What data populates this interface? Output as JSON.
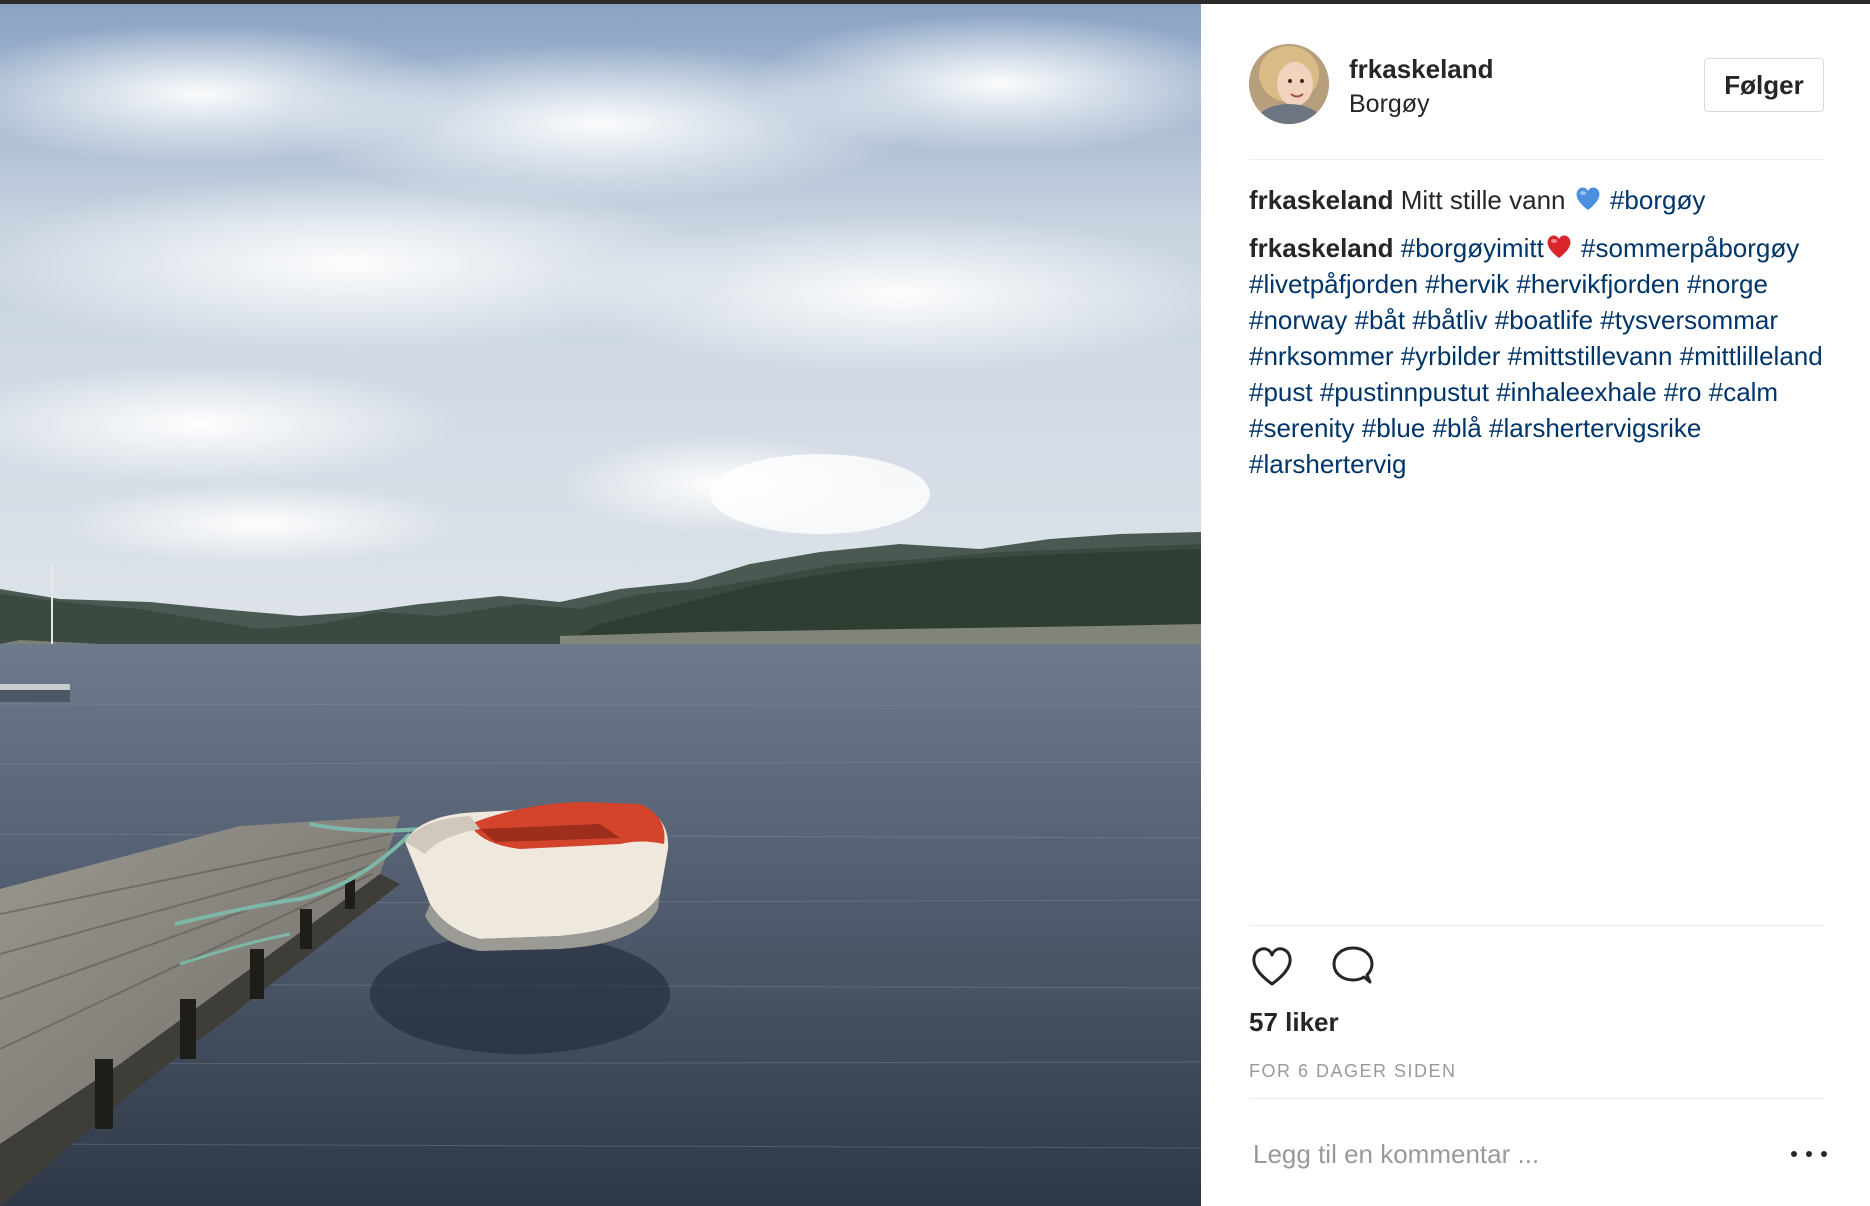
{
  "post": {
    "username": "frkaskeland",
    "location": "Borgøy",
    "follow_label": "Følger",
    "photo_icon": "lake-boat-photo",
    "comments": [
      {
        "user": "frkaskeland",
        "text": "Mitt stille vann",
        "emoji": "blue-heart",
        "tags": [
          "#borgøy"
        ]
      },
      {
        "user": "frkaskeland",
        "text": "",
        "tags_first": [
          "#borgøyimitt"
        ],
        "emoji": "red-heart",
        "tags": [
          "#sommerpåborgøy",
          "#livetpåfjorden",
          "#hervik",
          "#hervikfjorden",
          "#norge",
          "#norway",
          "#båt",
          "#båtliv",
          "#boatlife",
          "#tysversommar",
          "#nrksommer",
          "#yrbilder",
          "#mittstillevann",
          "#mittlilleland",
          "#pust",
          "#pustinnpustut",
          "#inhaleexhale",
          "#ro",
          "#calm",
          "#serenity",
          "#blue",
          "#blå",
          "#larshertervigsrike",
          "#larshertervig"
        ]
      }
    ],
    "actions": {
      "like_icon": "heart-icon",
      "comment_icon": "comment-icon"
    },
    "likes_text": "57 liker",
    "timestamp": "FOR 6 DAGER SIDEN",
    "comment_placeholder": "Legg til en kommentar ...",
    "more_icon": "more-options-icon"
  },
  "colors": {
    "hashtag": "#003569",
    "text": "#262626",
    "muted": "#999999",
    "border": "#efefef"
  }
}
